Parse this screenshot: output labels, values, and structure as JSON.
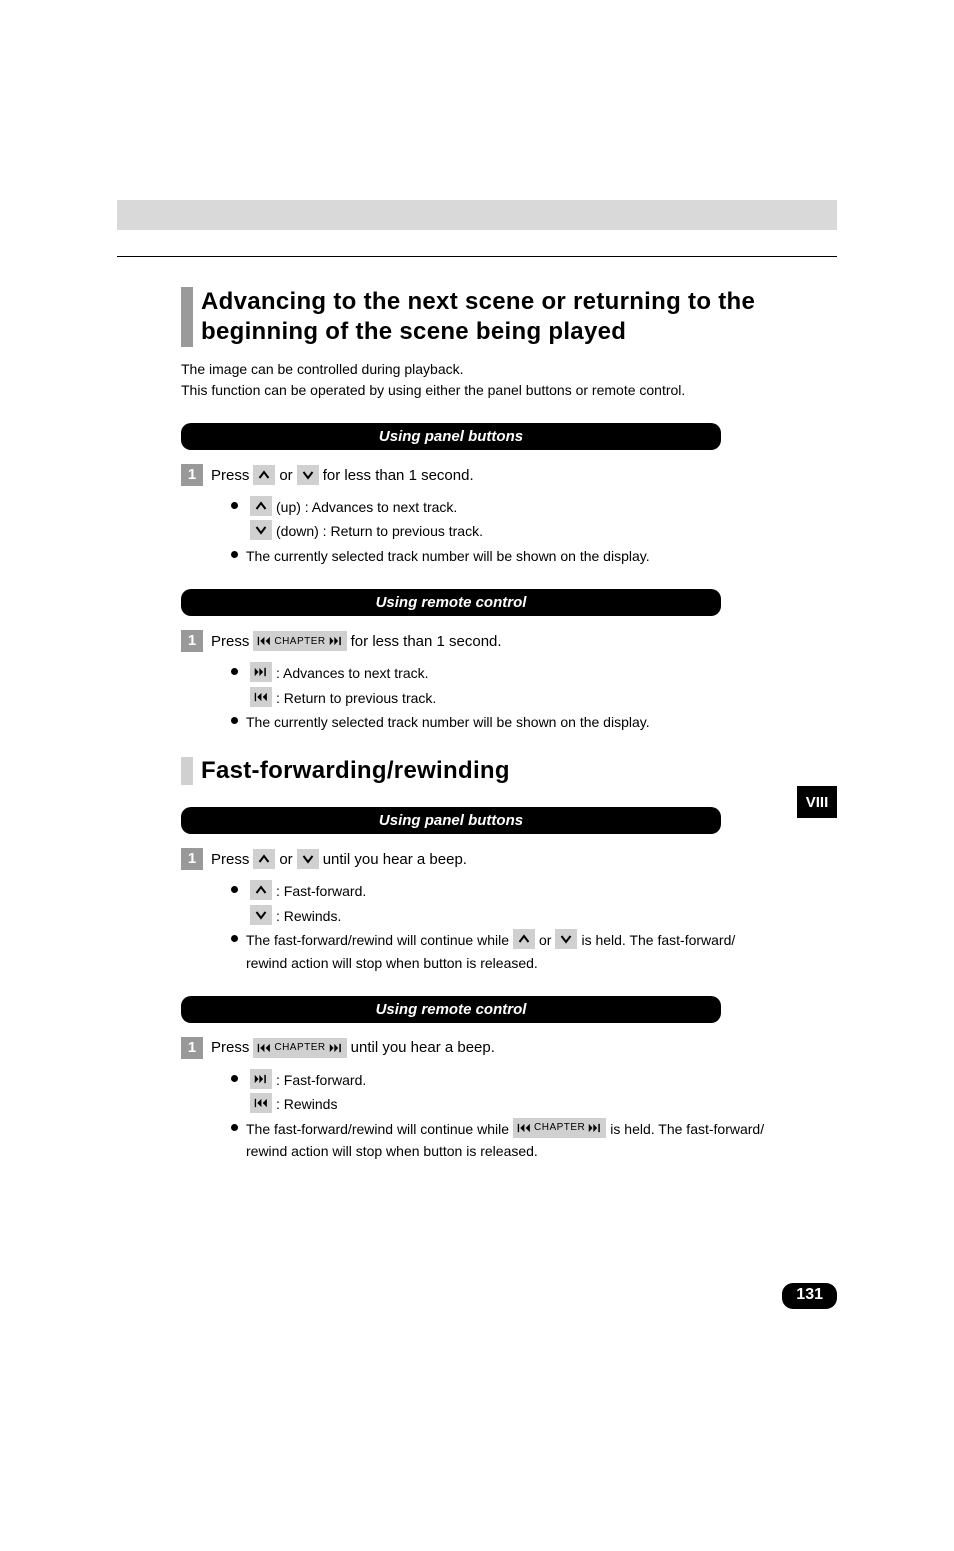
{
  "page_number": "131",
  "side_tab": "VIII",
  "section1": {
    "heading": "Advancing to the next scene or returning to the beginning of the scene being played",
    "intro1": "The image can be controlled during playback.",
    "intro2": "This function can be operated by using either the panel buttons or remote control.",
    "panel": {
      "bar": "Using panel buttons",
      "step_num": "1",
      "step_pre": "Press ",
      "step_mid": " or ",
      "step_post": " for less than 1 second.",
      "b1": " (up) : Advances to next track.",
      "b2": " (down) : Return to previous track.",
      "b3": "The currently selected track number will be shown on the display."
    },
    "remote": {
      "bar": "Using remote control",
      "step_num": "1",
      "step_pre": "Press ",
      "step_post": " for less than 1 second.",
      "chapter_label": "CHAPTER",
      "b1": " : Advances to next track.",
      "b2": " : Return to previous track.",
      "b3": "The currently selected track number will be shown on the display."
    }
  },
  "section2": {
    "heading": "Fast-forwarding/rewinding",
    "panel": {
      "bar": "Using panel buttons",
      "step_num": "1",
      "step_pre": "Press ",
      "step_mid": " or ",
      "step_post": " until you hear a beep.",
      "b1": " : Fast-forward.",
      "b2": " : Rewinds.",
      "b3_pre": "The fast-forward/rewind will continue while ",
      "b3_mid": " or ",
      "b3_post": " is held. The fast-forward/",
      "b3_line2": "rewind action will stop when button is released."
    },
    "remote": {
      "bar": "Using remote control",
      "step_num": "1",
      "step_pre": "Press ",
      "step_post": " until you hear a beep.",
      "chapter_label": "CHAPTER",
      "b1": " : Fast-forward.",
      "b2": " : Rewinds",
      "b3_pre": "The fast-forward/rewind will continue while ",
      "b3_post": " is held. The fast-forward/",
      "b3_line2": "rewind action will stop when button is released."
    }
  }
}
